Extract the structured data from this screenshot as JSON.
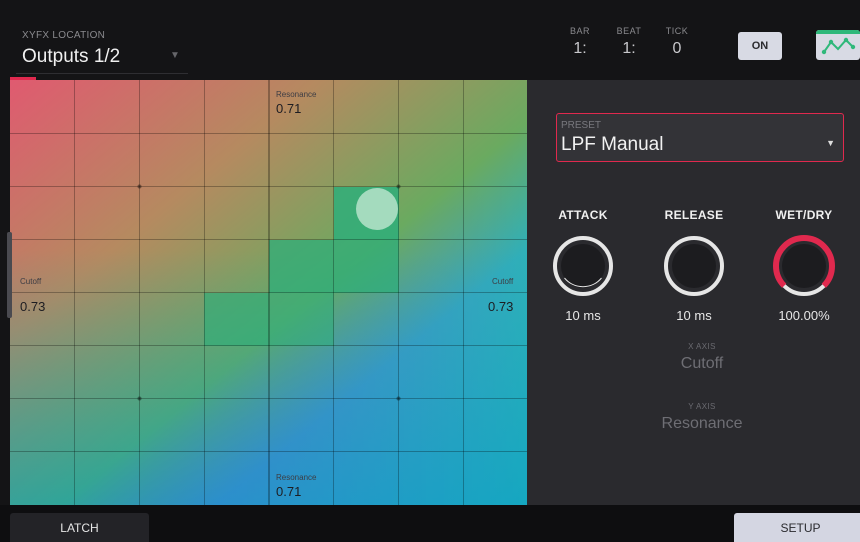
{
  "header": {
    "location_label": "XYFX LOCATION",
    "location_value": "Outputs 1/2",
    "bar_label": "BAR",
    "bar_value": "1:",
    "beat_label": "BEAT",
    "beat_value": "1:",
    "tick_label": "TICK",
    "tick_value": "0",
    "on_label": "ON",
    "curve_icon": "xy-curve-icon"
  },
  "pad": {
    "top_axis_label": "Resonance",
    "top_axis_value": "0.71",
    "bottom_axis_label": "Resonance",
    "bottom_axis_value": "0.71",
    "left_axis_label": "Cutoff",
    "left_axis_value": "0.73",
    "right_axis_label": "Cutoff",
    "right_axis_value": "0.73"
  },
  "panel": {
    "preset_label": "PRESET",
    "preset_value": "LPF Manual",
    "knobs": [
      {
        "title": "ATTACK",
        "value": "10 ms",
        "level": 0.0
      },
      {
        "title": "RELEASE",
        "value": "10 ms",
        "level": 0.0
      },
      {
        "title": "WET/DRY",
        "value": "100.00%",
        "level": 1.0
      }
    ],
    "x_axis_label": "X AXIS",
    "x_axis_value": "Cutoff",
    "y_axis_label": "Y AXIS",
    "y_axis_value": "Resonance"
  },
  "bottom": {
    "latch_label": "LATCH",
    "setup_label": "SETUP"
  },
  "colors": {
    "accent": "#e0294e",
    "background": "#141416",
    "panel": "#2a2a2e",
    "button_light": "#d8dae4"
  }
}
